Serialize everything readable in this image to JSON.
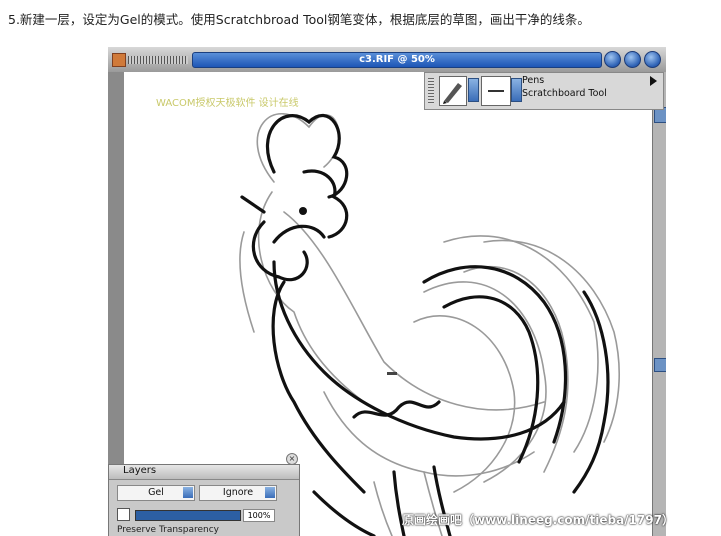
{
  "instruction": "5.新建一层，设定为Gel的模式。使用Scratchbroad Tool钢笔变体，根据底层的草图，画出干净的线条。",
  "window": {
    "title": "c3.RIF @ 50%"
  },
  "canvas": {
    "watermark_text": "WACOM授权天极软件 设计在线"
  },
  "brush_selector": {
    "category": "Pens",
    "variant": "Scratchboard Tool"
  },
  "layers_panel": {
    "title": "Layers",
    "composite_method": "Gel",
    "composite_depth": "Ignore",
    "opacity": "100%",
    "preserve_label": "Preserve Transparency"
  },
  "footer_watermark": "原画绘画吧（www.lineeg.com/tieba/1797）"
}
